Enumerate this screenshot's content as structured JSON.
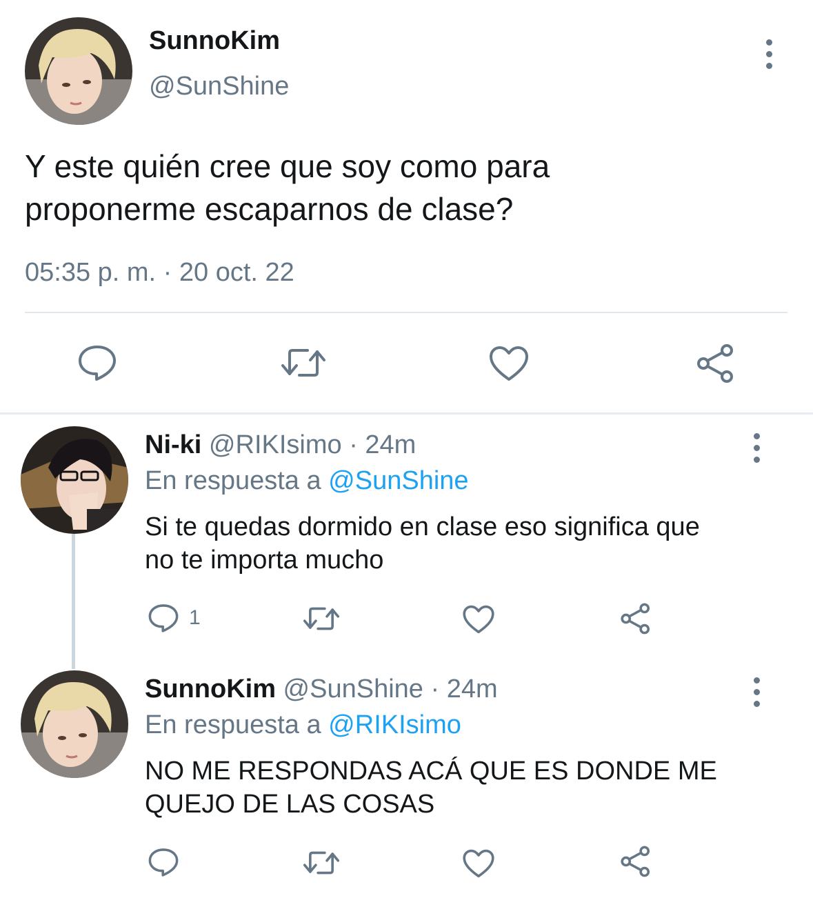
{
  "main_tweet": {
    "display_name": "SunnoKim",
    "handle": "@SunShine",
    "text_line1": "Y este quién cree que soy como para",
    "text_line2": "proponerme escaparnos de clase?",
    "timestamp": "05:35 p. m. · 20 oct. 22"
  },
  "replies": [
    {
      "display_name": "Ni-ki",
      "handle": "@RIKIsimo",
      "age": "· 24m",
      "reply_prefix": "En respuesta a",
      "reply_to": "@SunShine",
      "text_line1": "Si te quedas dormido en clase eso significa que",
      "text_line2": "no te importa mucho",
      "reply_count": "1"
    },
    {
      "display_name": "SunnoKim",
      "handle": "@SunShine",
      "age": "· 24m",
      "reply_prefix": "En respuesta a",
      "reply_to": "@RIKIsimo",
      "text_line1": "NO ME RESPONDAS ACÁ QUE ES DONDE ME",
      "text_line2": "QUEJO DE LAS COSAS",
      "reply_count": ""
    }
  ],
  "icons": {
    "reply": "speech-bubble-icon",
    "retweet": "retweet-icon",
    "like": "heart-icon",
    "share": "share-icon",
    "more": "vertical-dots-icon"
  },
  "colors": {
    "text": "#14171a",
    "muted": "#657786",
    "link": "#1da1f2",
    "divider": "#e1e8ed"
  }
}
